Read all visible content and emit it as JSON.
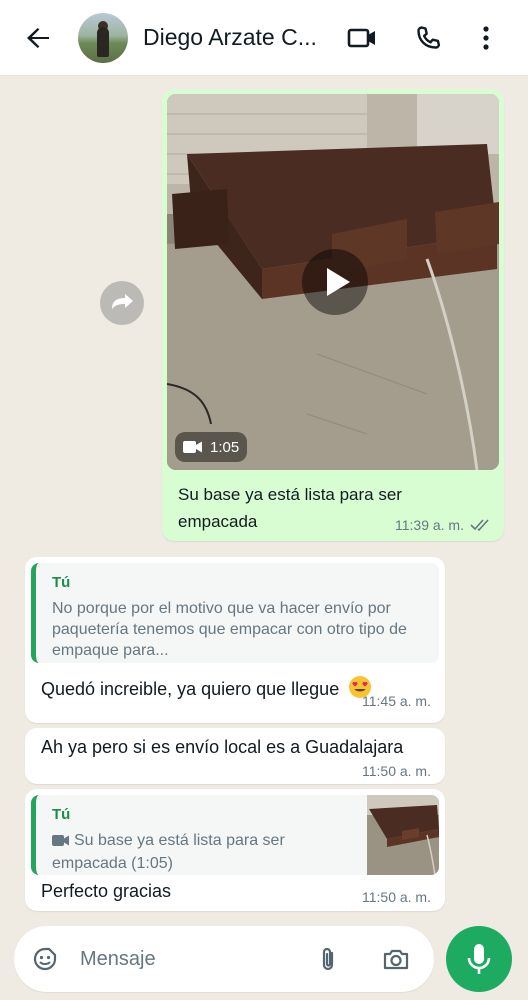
{
  "header": {
    "contact_name": "Diego Arzate C...",
    "icons": [
      "back-arrow-icon",
      "video-call-icon",
      "voice-call-icon",
      "more-options-icon"
    ]
  },
  "messages": {
    "outgoing_video": {
      "duration": "1:05",
      "caption": "Su base ya está lista para ser empacada",
      "time": "11:39 a. m.",
      "status": "read"
    },
    "reply1": {
      "quote_author": "Tú",
      "quote_text": "No porque por el motivo que va hacer envío por paquetería tenemos que empacar con otro tipo de empaque para...",
      "text": "Quedó increible, ya quiero que llegue",
      "emoji": "heart-eyes-emoji",
      "time": "11:45 a. m."
    },
    "msg2": {
      "text": "Ah ya pero si es envío local es a Guadalajara",
      "time": "11:50 a. m."
    },
    "reply2": {
      "quote_author": "Tú",
      "quote_text": "Su base ya está lista para ser empacada (1:05)",
      "text": "Perfecto gracias",
      "time": "11:50 a. m."
    }
  },
  "input": {
    "placeholder": "Mensaje",
    "value": ""
  },
  "colors": {
    "outgoing_bubble": "#d9fdd3",
    "incoming_bubble": "#ffffff",
    "accent_green": "#1daa61",
    "quote_bar": "#25a45c",
    "background": "#efeae2"
  }
}
